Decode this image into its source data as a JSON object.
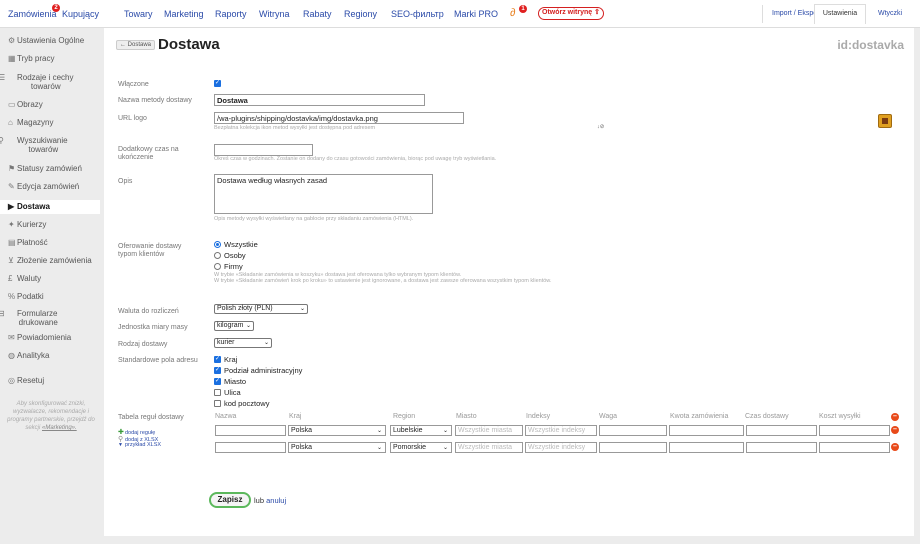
{
  "topnav": {
    "orders": "Zamówienia",
    "orders_badge": "2",
    "buyers": "Kupujący",
    "products": "Towary",
    "marketing": "Marketing",
    "reports": "Raporty",
    "storefront": "Witryna",
    "discounts": "Rabaty",
    "regions": "Regiony",
    "seo": "SEO-фильтр",
    "brands": "Marki PRO",
    "plugin_badge": "1",
    "open_store": "Otwórz witrynę ⇧",
    "import_export": "Import / Eksport",
    "settings": "Ustawienia",
    "plugins": "Wtyczki"
  },
  "sidebar": {
    "items": [
      {
        "icon": "gear-icon",
        "glyph": "⚙",
        "label": "Ustawienia Ogólne"
      },
      {
        "icon": "store-icon",
        "glyph": "▦",
        "label": "Tryb pracy"
      },
      {
        "icon": "list-icon",
        "glyph": "☰",
        "label": "Rodzaje i cechy",
        "label2": "towarów"
      },
      {
        "icon": "image-icon",
        "glyph": "▭",
        "label": "Obrazy"
      },
      {
        "icon": "warehouse-icon",
        "glyph": "⌂",
        "label": "Magazyny"
      },
      {
        "icon": "search-icon",
        "glyph": "⚲",
        "label": "Wyszukiwanie",
        "label2": "towarów"
      },
      {
        "icon": "flag-icon",
        "glyph": "⚑",
        "label": "Statusy zamówień"
      },
      {
        "icon": "edit-icon",
        "glyph": "✎",
        "label": "Edycja zamówień"
      },
      {
        "icon": "truck-icon",
        "glyph": "▶",
        "label": "Dostawa"
      },
      {
        "icon": "courier-icon",
        "glyph": "✦",
        "label": "Kurierzy"
      },
      {
        "icon": "card-icon",
        "glyph": "▤",
        "label": "Płatność"
      },
      {
        "icon": "cart-icon",
        "glyph": "⊻",
        "label": "Złożenie zamówienia"
      },
      {
        "icon": "currency-icon",
        "glyph": "£",
        "label": "Waluty"
      },
      {
        "icon": "percent-icon",
        "glyph": "%",
        "label": "Podatki"
      },
      {
        "icon": "form-icon",
        "glyph": "⊟",
        "label": "Formularze",
        "label2": "drukowane"
      },
      {
        "icon": "mail-icon",
        "glyph": "✉",
        "label": "Powiadomienia"
      },
      {
        "icon": "chart-icon",
        "glyph": "◍",
        "label": "Analityka"
      },
      {
        "icon": "reset-icon",
        "glyph": "◎",
        "label": "Resetuj"
      }
    ],
    "note": "Aby skonfigurować znizki, wyzwalacze, rekomendacje i programy partnerskie, przejdź do sekcji",
    "note_link": "«Marketing»."
  },
  "page": {
    "back": "← Dostawa",
    "title": "Dostawa",
    "id": "id:dostavka"
  },
  "form": {
    "enabled_label": "Włączone",
    "name_label": "Nazwa metody dostawy",
    "name_value": "Dostawa",
    "logo_label": "URL logo",
    "logo_value": "/wa-plugins/shipping/dostavka/img/dostavka.png",
    "logo_hint": "Bezpłatna kolekcja ikon metod wysyłki jest dostępna pod adresem",
    "logo_mark": "↓⊘",
    "extra_time_label": "Dodatkowy czas na ukończenie",
    "extra_time_hint": "Okreś czas w godzinach. Zostanie on dodany do czasu gotowości zamówienia, biorąc pod uwagę tryb wyświetlania.",
    "desc_label": "Opis",
    "desc_value": "Dostawa według własnych zasad",
    "desc_hint": "Opis metody wysyłki wyświetlany na gablocie przy składaniu zamówienia (HTML).",
    "customer_label": "Oferowanie dostawy typom klientów",
    "customer_options": [
      "Wszystkie",
      "Osoby",
      "Firmy"
    ],
    "customer_hint1": "W trybie «Składanie zamówienia w koszyku» dostawa jest oferowana tylko wybranym typom klientów.",
    "customer_hint2": "W trybie «Składanie zamówień krok po kroku» to ustawienie jest ignorowane, a dostawa jest zawsze oferowana wszystkim typom klientów.",
    "currency_label": "Waluta do rozliczeń",
    "currency_value": "Polish złoty (PLN)",
    "weight_label": "Jednostka miary masy",
    "weight_value": "kilogram",
    "type_label": "Rodzaj dostawy",
    "type_value": "kurier",
    "address_label": "Standardowe pola adresu",
    "address_fields": [
      {
        "label": "Kraj",
        "checked": true
      },
      {
        "label": "Podział administracyjny",
        "checked": true
      },
      {
        "label": "Miasto",
        "checked": true
      },
      {
        "label": "Ulica",
        "checked": false
      },
      {
        "label": "kod pocztowy",
        "checked": false
      }
    ],
    "rules_label": "Tabela reguł dostawy"
  },
  "rules": {
    "headers": [
      "Nazwa",
      "Kraj",
      "Region",
      "Miasto",
      "Indeksy",
      "Waga",
      "Kwota zamówienia",
      "Czas dostawy",
      "Koszt wysyłki"
    ],
    "actions": [
      {
        "icon": "plus-icon",
        "glyph": "✚",
        "label": "dodaj regułę"
      },
      {
        "icon": "paperclip-icon",
        "glyph": "⚲",
        "label": "dodaj z XLSX"
      },
      {
        "icon": "download-icon",
        "glyph": "▼",
        "label": "przykład XLSX"
      }
    ],
    "city_placeholder": "Wszystkie miasta",
    "index_placeholder": "Wszystkie indeksy",
    "rows": [
      {
        "country": "Polska",
        "region": "Lubelskie"
      },
      {
        "country": "Polska",
        "region": "Pomorskie"
      }
    ]
  },
  "footer": {
    "save": "Zapisz",
    "or": "lub",
    "cancel": "anuluj"
  },
  "colors": {
    "link": "#2a4aa8",
    "save_border": "#5cb85c",
    "danger": "#e84a1a",
    "checkbox": "#1a6fe0"
  }
}
